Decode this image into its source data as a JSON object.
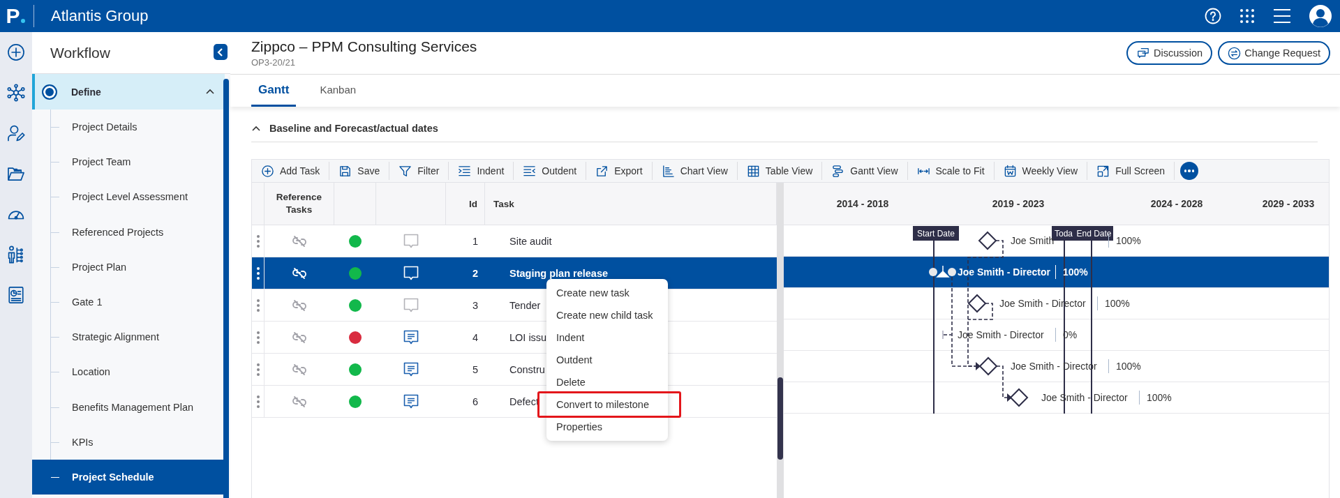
{
  "app_bar": {
    "logo": "P",
    "title": "Atlantis Group"
  },
  "workflow": {
    "title": "Workflow",
    "phase": {
      "label": "Define",
      "expanded": true,
      "children": [
        {
          "label": "Project Details",
          "selected": false
        },
        {
          "label": "Project Team",
          "selected": false
        },
        {
          "label": "Project Level Assessment",
          "selected": false
        },
        {
          "label": "Referenced Projects",
          "selected": false
        },
        {
          "label": "Project Plan",
          "selected": false
        },
        {
          "label": "Gate 1",
          "selected": false
        },
        {
          "label": "Strategic Alignment",
          "selected": false
        },
        {
          "label": "Location",
          "selected": false
        },
        {
          "label": "Benefits Management Plan",
          "selected": false
        },
        {
          "label": "KPIs",
          "selected": false
        },
        {
          "label": "Project Schedule",
          "selected": true
        }
      ]
    }
  },
  "header": {
    "title": "Zippco – PPM Consulting Services",
    "subtitle": "OP3-20/21",
    "buttons": [
      "Discussion",
      "Change Request"
    ]
  },
  "tabs": [
    {
      "label": "Gantt",
      "selected": true
    },
    {
      "label": "Kanban",
      "selected": false
    }
  ],
  "section": {
    "title": "Baseline and Forecast/actual dates",
    "expanded": true
  },
  "toolbar": [
    "Add Task",
    "Save",
    "Filter",
    "Indent",
    "Outdent",
    "Export",
    "Chart View",
    "Table View",
    "Gantt View",
    "Scale to Fit",
    "Weekly View",
    "Full Screen"
  ],
  "table": {
    "columns": [
      "Reference Tasks",
      "Id",
      "Task"
    ],
    "rows": [
      {
        "id": "1",
        "task": "Site audit",
        "color": "#12b84b",
        "has_comments": false,
        "selected": false,
        "resource": "Joe Smith",
        "percent": "100%",
        "kind": "milestone"
      },
      {
        "id": "2",
        "task": "Staging plan release",
        "color": "#12b84b",
        "has_comments": false,
        "selected": true,
        "resource": "Joe Smith - Director",
        "percent": "100%",
        "kind": "handle"
      },
      {
        "id": "3",
        "task": "Tender",
        "color": "#12b84b",
        "has_comments": false,
        "selected": false,
        "resource": "Joe Smith - Director",
        "percent": "100%",
        "kind": "milestone"
      },
      {
        "id": "4",
        "task": "LOI issu",
        "color": "#d92b3f",
        "has_comments": true,
        "selected": false,
        "resource": "Joe Smith - Director",
        "percent": "0%",
        "kind": "tick"
      },
      {
        "id": "5",
        "task": "Constru",
        "color": "#12b84b",
        "has_comments": true,
        "selected": false,
        "resource": "Joe Smith - Director",
        "percent": "100%",
        "kind": "milestone"
      },
      {
        "id": "6",
        "task": "Defect",
        "color": "#12b84b",
        "has_comments": true,
        "selected": false,
        "resource": "Joe Smith - Director",
        "percent": "100%",
        "kind": "milestone"
      }
    ]
  },
  "timeline": {
    "periods": [
      "2014 - 2018",
      "2019 - 2023",
      "2024 - 2028",
      "2029 - 2033"
    ],
    "markers": [
      "Start Date",
      "Toda",
      "End Date"
    ]
  },
  "context_menu": [
    {
      "label": "Create new task",
      "highlighted": false
    },
    {
      "label": "Create new child task",
      "highlighted": false
    },
    {
      "label": "Indent",
      "highlighted": false
    },
    {
      "label": "Outdent",
      "highlighted": false
    },
    {
      "label": "Delete",
      "highlighted": false
    },
    {
      "label": "Convert to milestone",
      "highlighted": true
    },
    {
      "label": "Properties",
      "highlighted": false
    }
  ]
}
